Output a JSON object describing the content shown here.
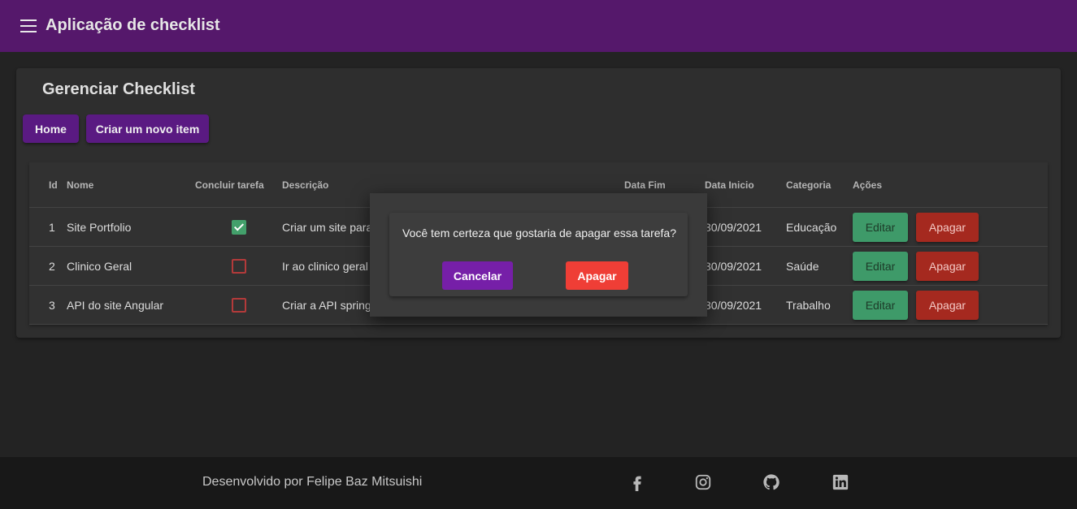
{
  "app": {
    "title": "Aplicação de checklist"
  },
  "page": {
    "title": "Gerenciar Checklist",
    "home_label": "Home",
    "new_item_label": "Criar um novo item"
  },
  "table": {
    "headers": {
      "id": "Id",
      "name": "Nome",
      "complete": "Concluir tarefa",
      "description": "Descrição",
      "end_date": "Data Fim",
      "start_date": "Data Inicio",
      "category": "Categoria",
      "actions": "Ações"
    },
    "rows": [
      {
        "id": "1",
        "name": "Site Portfolio",
        "completed": true,
        "description": "Criar um site para",
        "start_date": "30/09/2021",
        "category": "Educação",
        "edit": "Editar",
        "delete": "Apagar"
      },
      {
        "id": "2",
        "name": "Clinico Geral",
        "completed": false,
        "description": "Ir ao clinico geral",
        "start_date": "30/09/2021",
        "category": "Saúde",
        "edit": "Editar",
        "delete": "Apagar"
      },
      {
        "id": "3",
        "name": "API do site Angular",
        "completed": false,
        "description": "Criar a API spring",
        "start_date": "30/09/2021",
        "category": "Trabalho",
        "edit": "Editar",
        "delete": "Apagar"
      }
    ]
  },
  "dialog": {
    "message": "Você tem certeza que gostaria de apagar essa tarefa?",
    "cancel_label": "Cancelar",
    "confirm_label": "Apagar"
  },
  "footer": {
    "credit": "Desenvolvido por Felipe Baz Mitsuishi",
    "icons": [
      "facebook-icon",
      "instagram-icon",
      "github-icon",
      "linkedin-icon"
    ]
  },
  "colors": {
    "toolbar": "#55186b",
    "primary": "#5a1a82",
    "edit": "#3e9a69",
    "delete": "#a5291f",
    "confirm": "#ef3e36",
    "checked": "#43a06b"
  }
}
